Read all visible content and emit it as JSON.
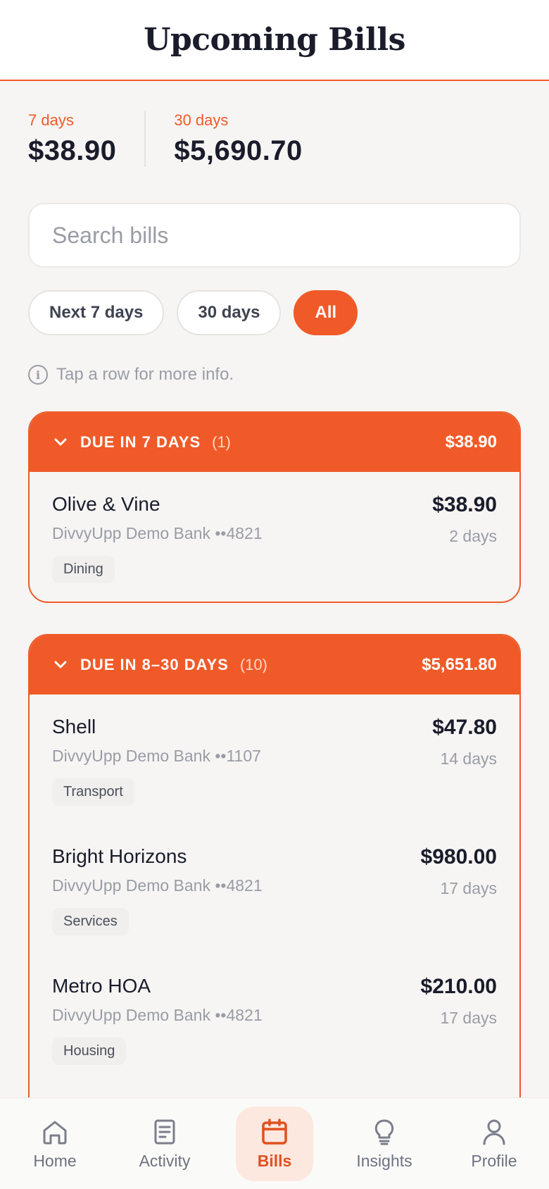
{
  "header": {
    "title": "Upcoming Bills"
  },
  "summary": [
    {
      "period": "7 days",
      "amount": "$38.90"
    },
    {
      "period": "30 days",
      "amount": "$5,690.70"
    }
  ],
  "search": {
    "placeholder": "Search bills",
    "value": ""
  },
  "filters": [
    {
      "label": "Next 7 days",
      "active": false
    },
    {
      "label": "30 days",
      "active": false
    },
    {
      "label": "All",
      "active": true
    }
  ],
  "hint": "Tap a row for more info.",
  "groups": [
    {
      "title": "DUE IN 7 DAYS",
      "count": "(1)",
      "total": "$38.90",
      "bills": [
        {
          "name": "Olive & Vine",
          "account": "DivvyUpp Demo Bank ••4821",
          "category": "Dining",
          "amount": "$38.90",
          "due": "2 days"
        }
      ]
    },
    {
      "title": "DUE IN 8–30 DAYS",
      "count": "(10)",
      "total": "$5,651.80",
      "bills": [
        {
          "name": "Shell",
          "account": "DivvyUpp Demo Bank ••1107",
          "category": "Transport",
          "amount": "$47.80",
          "due": "14 days"
        },
        {
          "name": "Bright Horizons",
          "account": "DivvyUpp Demo Bank ••4821",
          "category": "Services",
          "amount": "$980.00",
          "due": "17 days"
        },
        {
          "name": "Metro HOA",
          "account": "DivvyUpp Demo Bank ••4821",
          "category": "Housing",
          "amount": "$210.00",
          "due": "17 days"
        }
      ]
    }
  ],
  "tabbar": [
    {
      "label": "Home",
      "icon": "home-icon",
      "active": false
    },
    {
      "label": "Activity",
      "icon": "activity-icon",
      "active": false
    },
    {
      "label": "Bills",
      "icon": "calendar-icon",
      "active": true
    },
    {
      "label": "Insights",
      "icon": "lightbulb-icon",
      "active": false
    },
    {
      "label": "Profile",
      "icon": "user-icon",
      "active": false
    }
  ],
  "colors": {
    "accent": "#f05a28",
    "text": "#1a1c2b",
    "muted": "#9a9ca5",
    "background": "#f6f5f4"
  }
}
